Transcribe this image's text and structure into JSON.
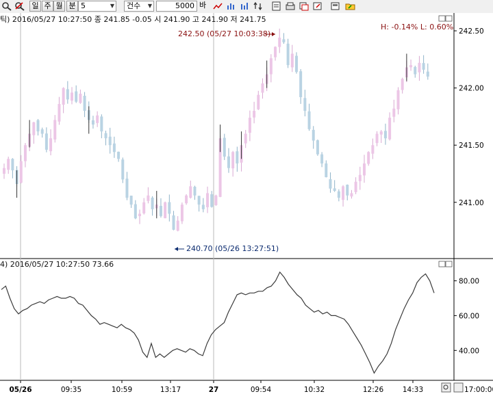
{
  "toolbar": {
    "period_buttons": [
      "일",
      "주",
      "월",
      "분"
    ],
    "interval_value": "5",
    "count_type": "건수",
    "count_value": "5000",
    "count_unit": "바",
    "icons": [
      "magnifier-icon",
      "unzoom-icon",
      "line-draw-icon",
      "bar-chart-icon",
      "bar-chart-2-icon",
      "bar-chart-3-icon",
      "bar-chart-4-icon",
      "sort-icon",
      "page-icon",
      "print-icon",
      "copy-icon",
      "export-icon",
      "save-icon",
      "folder-icon"
    ]
  },
  "price_panel": {
    "header": "틱) 2016/05/27 10:27:50  종 241.85 -0.05  시 241.90 고 241.90 저 241.75",
    "high_low": "H: -0.14%  L: 0.60%",
    "high_label": "242.50 (05/27 10:03:38)",
    "low_label": "240.70 (05/26 13:27:51)"
  },
  "indicator_panel": {
    "header": "4) 2016/05/27 10:27:50 73.66"
  },
  "x_axis": {
    "labels": [
      "05/26",
      "09:35",
      "10:59",
      "13:17",
      "27",
      "09:54",
      "10:32",
      "12:26",
      "14:33"
    ],
    "right_label": "17:00:00"
  },
  "colors": {
    "up": "#ecc6e6",
    "down": "#b9d3e3",
    "line": "#3a3a3a",
    "high_label": "#8a1010",
    "low_label": "#0a2a6e"
  },
  "chart_data": [
    {
      "type": "candlestick",
      "ylim": [
        240.55,
        242.62
      ],
      "yticks": [
        "242.50",
        "242.00",
        "241.50",
        "241.00"
      ],
      "ytick_values": [
        242.5,
        242.0,
        241.5,
        241.0
      ],
      "high": 242.5,
      "low": 240.7,
      "close_series": [
        241.3,
        241.38,
        241.28,
        241.16,
        241.36,
        241.5,
        241.6,
        241.7,
        241.62,
        241.6,
        241.46,
        241.56,
        241.72,
        241.86,
        242.0,
        241.9,
        241.96,
        241.88,
        241.95,
        241.8,
        241.72,
        241.68,
        241.76,
        241.62,
        241.56,
        241.5,
        241.44,
        241.38,
        241.2,
        241.04,
        240.98,
        240.86,
        240.9,
        241.0,
        241.06,
        240.94,
        240.98,
        240.88,
        241.0,
        240.9,
        240.76,
        240.84,
        240.98,
        241.06,
        241.14,
        241.06,
        240.98,
        240.94,
        241.08,
        240.96,
        241.06,
        241.56,
        241.4,
        241.3,
        241.44,
        241.34,
        241.5,
        241.6,
        241.74,
        241.8,
        241.94,
        242.04,
        242.12,
        242.26,
        242.36,
        242.44,
        242.4,
        242.2,
        242.3,
        242.14,
        241.92,
        241.8,
        241.64,
        241.54,
        241.42,
        241.34,
        241.22,
        241.12,
        241.1,
        241.04,
        241.14,
        241.06,
        241.08,
        241.18,
        241.24,
        241.34,
        241.44,
        241.5,
        241.6,
        241.62,
        241.56,
        241.74,
        241.82,
        241.98,
        242.08,
        242.18,
        242.2,
        242.12,
        242.22,
        242.16,
        242.1
      ]
    },
    {
      "type": "line",
      "yticks": [
        "80.00",
        "60.00",
        "40.00"
      ],
      "ytick_values": [
        80,
        60,
        40
      ],
      "ylim": [
        24,
        92
      ],
      "last_value": 73.66,
      "values": [
        75,
        77,
        70,
        64,
        61,
        63,
        64,
        66,
        67,
        68,
        67,
        69,
        70,
        71,
        70,
        70,
        71,
        70,
        67,
        66,
        63,
        60,
        58,
        55,
        56,
        55,
        54,
        53,
        55,
        53,
        52,
        50,
        46,
        39,
        36,
        44,
        36,
        38,
        36,
        38,
        40,
        41,
        40,
        39,
        41,
        40,
        38,
        37,
        44,
        49,
        52,
        54,
        56,
        62,
        67,
        72,
        73,
        72,
        73,
        73,
        74,
        74,
        76,
        77,
        80,
        85,
        82,
        78,
        75,
        72,
        70,
        66,
        64,
        62,
        63,
        61,
        62,
        60,
        60,
        59,
        58,
        55,
        51,
        47,
        43,
        38,
        33,
        27,
        31,
        34,
        38,
        44,
        52,
        58,
        64,
        69,
        73,
        79,
        82,
        84,
        80,
        73
      ]
    }
  ]
}
